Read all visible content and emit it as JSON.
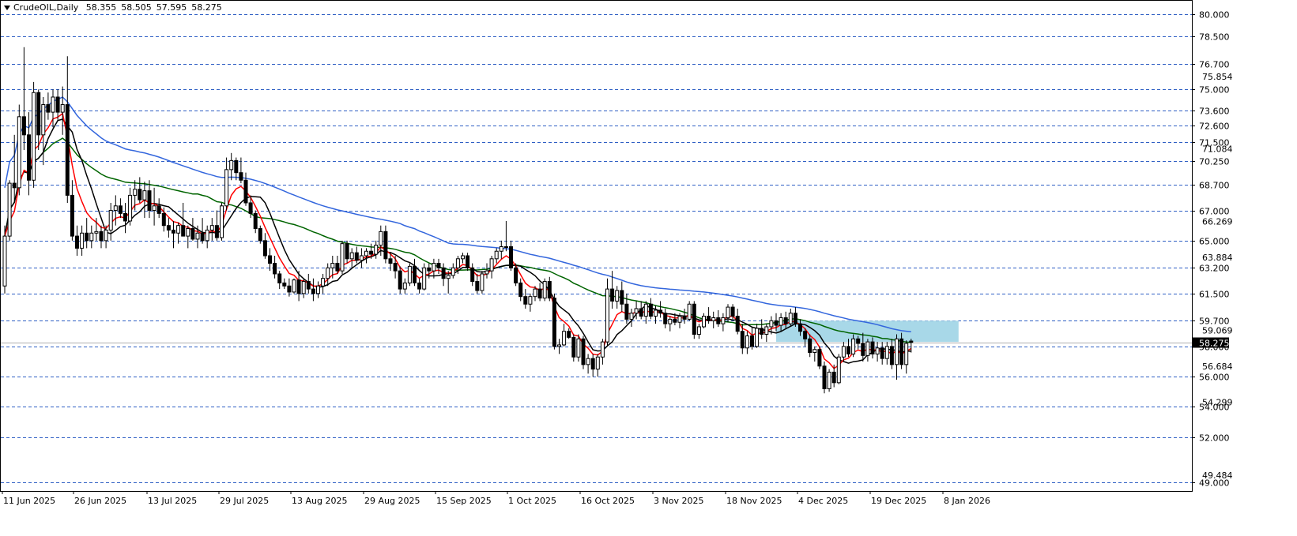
{
  "header": {
    "symbol_timeframe": "CrudeOIL,Daily",
    "open": "58.355",
    "high": "58.505",
    "low": "57.595",
    "close": "58.275"
  },
  "colors": {
    "background": "#ffffff",
    "gridline": "#2f5fc4",
    "candle": "#000000",
    "ma_red": "#ff0000",
    "ma_black": "#000000",
    "ma_green": "#006400",
    "ma_blue": "#3366dd",
    "zone": "#a8d8e8",
    "price_line": "#b0b0b0"
  },
  "chart_data": {
    "type": "candlestick",
    "title": "CrudeOIL,Daily",
    "ylim": [
      48.8,
      80.4
    ],
    "grid": "horizontal dashed lines at level labels",
    "price_levels": [
      "80.000",
      "78.500",
      "76.700",
      "75.000",
      "73.600",
      "72.600",
      "71.500",
      "70.250",
      "68.700",
      "67.000",
      "65.000",
      "63.200",
      "61.500",
      "59.700",
      "58.000",
      "56.000",
      "54.000",
      "52.000",
      "49.000"
    ],
    "extra_scale_labels": [
      "75.854",
      "71.084",
      "66.269",
      "63.884",
      "59.069",
      "56.684",
      "54.299",
      "49.484"
    ],
    "current_price": "58.275",
    "x_labels": [
      "11 Jun 2025",
      "26 Jun 2025",
      "13 Jul 2025",
      "29 Jul 2025",
      "13 Aug 2025",
      "29 Aug 2025",
      "15 Sep 2025",
      "1 Oct 2025",
      "16 Oct 2025",
      "3 Nov 2025",
      "18 Nov 2025",
      "4 Dec 2025",
      "19 Dec 2025",
      "8 Jan 2026"
    ],
    "zone": {
      "from_label": "4 Dec 2025",
      "to_label": "8 Jan 2026",
      "y_low": 58.3,
      "y_high": 59.7
    },
    "candles": [
      [
        62.0,
        66.0,
        61.5,
        65.3
      ],
      [
        65.3,
        69.0,
        65.0,
        68.8
      ],
      [
        68.8,
        72.0,
        67.5,
        68.5
      ],
      [
        68.5,
        74.0,
        68.0,
        73.2
      ],
      [
        73.2,
        77.8,
        71.0,
        72.0
      ],
      [
        72.0,
        73.5,
        68.0,
        69.0
      ],
      [
        69.0,
        75.5,
        68.5,
        74.8
      ],
      [
        74.8,
        75.0,
        71.0,
        72.0
      ],
      [
        72.0,
        74.5,
        70.0,
        74.0
      ],
      [
        74.0,
        74.8,
        73.0,
        73.5
      ],
      [
        73.5,
        75.0,
        72.5,
        74.5
      ],
      [
        74.5,
        75.0,
        73.0,
        73.5
      ],
      [
        73.5,
        75.2,
        72.0,
        74.0
      ],
      [
        74.0,
        77.2,
        67.5,
        68.0
      ],
      [
        68.0,
        69.0,
        65.0,
        65.3
      ],
      [
        65.3,
        66.0,
        64.0,
        64.5
      ],
      [
        64.5,
        66.0,
        64.0,
        65.5
      ],
      [
        65.5,
        66.5,
        64.5,
        65.0
      ],
      [
        65.0,
        66.0,
        64.5,
        65.5
      ],
      [
        65.5,
        66.5,
        65.0,
        65.6
      ],
      [
        65.6,
        66.0,
        64.5,
        65.0
      ],
      [
        65.0,
        66.0,
        64.5,
        65.7
      ],
      [
        65.7,
        67.5,
        65.0,
        67.0
      ],
      [
        67.0,
        68.0,
        66.0,
        67.3
      ],
      [
        67.3,
        67.8,
        66.5,
        66.8
      ],
      [
        66.8,
        67.5,
        65.5,
        66.3
      ],
      [
        66.3,
        68.5,
        66.0,
        68.0
      ],
      [
        68.0,
        69.0,
        67.0,
        68.4
      ],
      [
        68.4,
        69.2,
        67.5,
        67.7
      ],
      [
        67.7,
        68.9,
        66.5,
        68.3
      ],
      [
        68.3,
        69.0,
        66.5,
        67.0
      ],
      [
        67.0,
        68.5,
        66.0,
        67.3
      ],
      [
        67.3,
        67.8,
        66.5,
        66.8
      ],
      [
        66.8,
        67.2,
        65.6,
        66.0
      ],
      [
        66.0,
        66.5,
        65.2,
        65.7
      ],
      [
        65.7,
        66.3,
        64.5,
        65.5
      ],
      [
        65.5,
        66.2,
        64.8,
        66.0
      ],
      [
        66.0,
        67.5,
        65.5,
        65.3
      ],
      [
        65.3,
        66.0,
        64.5,
        65.8
      ],
      [
        65.8,
        66.5,
        65.0,
        65.1
      ],
      [
        65.1,
        66.0,
        64.5,
        65.5
      ],
      [
        65.5,
        66.5,
        64.8,
        65.0
      ],
      [
        65.0,
        66.0,
        64.5,
        65.7
      ],
      [
        65.7,
        66.5,
        65.0,
        66.0
      ],
      [
        66.0,
        67.0,
        65.0,
        65.2
      ],
      [
        65.2,
        67.5,
        65.0,
        67.3
      ],
      [
        67.3,
        70.5,
        67.0,
        69.7
      ],
      [
        69.7,
        70.8,
        69.0,
        70.3
      ],
      [
        70.3,
        70.5,
        69.0,
        69.5
      ],
      [
        69.5,
        70.5,
        68.8,
        69.0
      ],
      [
        69.0,
        69.5,
        67.3,
        67.5
      ],
      [
        67.5,
        68.0,
        66.5,
        66.8
      ],
      [
        66.8,
        67.0,
        65.5,
        65.8
      ],
      [
        65.8,
        66.0,
        64.8,
        65.0
      ],
      [
        65.0,
        65.5,
        63.8,
        64.0
      ],
      [
        64.0,
        64.5,
        63.0,
        63.5
      ],
      [
        63.5,
        64.0,
        62.5,
        62.8
      ],
      [
        62.8,
        63.0,
        61.8,
        62.2
      ],
      [
        62.2,
        62.5,
        61.8,
        62.0
      ],
      [
        62.0,
        62.5,
        61.3,
        61.6
      ],
      [
        61.6,
        62.5,
        61.5,
        62.4
      ],
      [
        62.4,
        63.0,
        61.0,
        61.5
      ],
      [
        61.5,
        62.5,
        61.2,
        62.3
      ],
      [
        62.3,
        62.8,
        61.5,
        61.8
      ],
      [
        61.8,
        62.5,
        61.0,
        61.5
      ],
      [
        61.5,
        62.3,
        61.2,
        62.0
      ],
      [
        62.0,
        62.8,
        61.5,
        62.5
      ],
      [
        62.5,
        63.5,
        62.0,
        63.2
      ],
      [
        63.2,
        64.0,
        62.5,
        63.5
      ],
      [
        63.5,
        64.0,
        62.8,
        63.0
      ],
      [
        63.0,
        65.0,
        62.8,
        64.8
      ],
      [
        64.8,
        65.0,
        63.5,
        63.8
      ],
      [
        63.8,
        64.5,
        63.2,
        64.2
      ],
      [
        64.2,
        64.6,
        63.5,
        63.7
      ],
      [
        63.7,
        64.5,
        63.2,
        64.0
      ],
      [
        64.0,
        64.5,
        63.5,
        64.3
      ],
      [
        64.3,
        64.8,
        63.8,
        64.1
      ],
      [
        64.1,
        65.0,
        63.8,
        64.7
      ],
      [
        64.7,
        66.0,
        64.0,
        65.6
      ],
      [
        65.6,
        66.0,
        63.5,
        63.8
      ],
      [
        63.8,
        64.2,
        63.0,
        63.5
      ],
      [
        63.5,
        64.0,
        62.5,
        63.0
      ],
      [
        63.0,
        63.3,
        61.5,
        61.8
      ],
      [
        61.8,
        62.5,
        61.5,
        62.2
      ],
      [
        62.2,
        63.5,
        62.0,
        63.3
      ],
      [
        63.3,
        63.8,
        62.0,
        62.2
      ],
      [
        62.2,
        62.5,
        61.5,
        61.8
      ],
      [
        61.8,
        63.5,
        61.7,
        63.2
      ],
      [
        63.2,
        63.5,
        62.5,
        63.0
      ],
      [
        63.0,
        63.8,
        62.5,
        63.5
      ],
      [
        63.5,
        63.8,
        62.8,
        63.2
      ],
      [
        63.2,
        63.5,
        62.0,
        62.5
      ],
      [
        62.5,
        63.0,
        61.5,
        62.7
      ],
      [
        62.7,
        63.5,
        62.5,
        63.2
      ],
      [
        63.2,
        64.0,
        62.8,
        63.8
      ],
      [
        63.8,
        64.2,
        63.5,
        64.0
      ],
      [
        64.0,
        64.2,
        63.0,
        63.2
      ],
      [
        63.2,
        63.5,
        62.0,
        62.3
      ],
      [
        62.3,
        62.8,
        61.5,
        61.7
      ],
      [
        61.7,
        63.0,
        61.5,
        62.8
      ],
      [
        62.8,
        63.5,
        62.5,
        63.0
      ],
      [
        63.0,
        64.0,
        62.5,
        63.8
      ],
      [
        63.8,
        64.5,
        63.5,
        64.3
      ],
      [
        64.3,
        65.0,
        63.8,
        64.6
      ],
      [
        64.6,
        66.3,
        64.3,
        64.6
      ],
      [
        64.6,
        65.0,
        63.0,
        63.2
      ],
      [
        63.2,
        63.5,
        62.0,
        62.2
      ],
      [
        62.2,
        62.5,
        61.0,
        61.3
      ],
      [
        61.3,
        61.8,
        60.5,
        60.8
      ],
      [
        60.8,
        61.5,
        60.3,
        61.3
      ],
      [
        61.3,
        62.0,
        61.0,
        61.8
      ],
      [
        61.8,
        62.2,
        61.0,
        61.2
      ],
      [
        61.2,
        62.5,
        61.0,
        62.3
      ],
      [
        62.3,
        62.6,
        61.0,
        61.2
      ],
      [
        61.2,
        61.5,
        57.8,
        58.0
      ],
      [
        58.0,
        58.5,
        57.5,
        58.1
      ],
      [
        58.1,
        59.5,
        58.0,
        59.0
      ],
      [
        59.0,
        59.2,
        58.5,
        58.6
      ],
      [
        58.6,
        58.8,
        57.0,
        57.3
      ],
      [
        57.3,
        58.8,
        57.0,
        58.5
      ],
      [
        58.5,
        58.7,
        56.5,
        56.8
      ],
      [
        56.8,
        57.5,
        56.2,
        57.2
      ],
      [
        57.2,
        57.5,
        56.0,
        56.5
      ],
      [
        56.5,
        57.5,
        56.0,
        57.3
      ],
      [
        57.3,
        58.5,
        56.8,
        58.3
      ],
      [
        58.3,
        62.5,
        58.0,
        61.8
      ],
      [
        61.8,
        63.0,
        60.5,
        61.0
      ],
      [
        61.0,
        62.0,
        60.5,
        61.7
      ],
      [
        61.7,
        62.3,
        60.3,
        60.8
      ],
      [
        60.8,
        61.5,
        59.5,
        59.8
      ],
      [
        59.8,
        60.5,
        59.3,
        60.2
      ],
      [
        60.2,
        61.0,
        59.8,
        60.5
      ],
      [
        60.5,
        61.0,
        59.8,
        60.0
      ],
      [
        60.0,
        61.0,
        59.5,
        60.8
      ],
      [
        60.8,
        61.2,
        59.8,
        60.0
      ],
      [
        60.0,
        60.7,
        59.5,
        60.4
      ],
      [
        60.4,
        61.0,
        59.9,
        60.2
      ],
      [
        60.2,
        60.5,
        59.2,
        59.5
      ],
      [
        59.5,
        60.0,
        59.0,
        59.8
      ],
      [
        59.8,
        60.2,
        59.4,
        59.6
      ],
      [
        59.6,
        60.2,
        59.2,
        60.0
      ],
      [
        60.0,
        60.5,
        59.5,
        59.8
      ],
      [
        59.8,
        61.0,
        59.7,
        60.8
      ],
      [
        60.8,
        61.0,
        58.5,
        58.8
      ],
      [
        58.8,
        59.5,
        58.5,
        59.3
      ],
      [
        59.3,
        60.2,
        59.2,
        60.0
      ],
      [
        60.0,
        60.6,
        59.5,
        59.7
      ],
      [
        59.7,
        60.3,
        59.2,
        59.9
      ],
      [
        59.9,
        60.4,
        59.3,
        59.5
      ],
      [
        59.5,
        60.2,
        59.0,
        59.9
      ],
      [
        59.9,
        60.8,
        59.6,
        60.6
      ],
      [
        60.6,
        60.8,
        59.8,
        60.0
      ],
      [
        60.0,
        60.5,
        58.8,
        59.0
      ],
      [
        59.0,
        59.5,
        57.5,
        57.9
      ],
      [
        57.9,
        59.0,
        57.5,
        58.7
      ],
      [
        58.7,
        59.3,
        57.8,
        58.0
      ],
      [
        58.0,
        59.5,
        57.9,
        59.2
      ],
      [
        59.2,
        59.8,
        58.5,
        58.8
      ],
      [
        58.8,
        59.5,
        58.3,
        59.3
      ],
      [
        59.3,
        60.0,
        58.8,
        59.7
      ],
      [
        59.7,
        60.2,
        59.0,
        59.4
      ],
      [
        59.4,
        60.2,
        59.0,
        59.9
      ],
      [
        59.9,
        60.3,
        59.2,
        59.5
      ],
      [
        59.5,
        60.5,
        59.3,
        60.2
      ],
      [
        60.2,
        60.6,
        59.3,
        59.5
      ],
      [
        59.5,
        59.8,
        58.7,
        59.0
      ],
      [
        59.0,
        59.2,
        58.0,
        58.5
      ],
      [
        58.5,
        58.8,
        57.3,
        57.6
      ],
      [
        57.6,
        58.0,
        57.0,
        57.8
      ],
      [
        57.8,
        58.0,
        56.5,
        56.7
      ],
      [
        56.7,
        57.0,
        54.9,
        55.2
      ],
      [
        55.2,
        56.5,
        55.0,
        56.3
      ],
      [
        56.3,
        56.8,
        55.3,
        55.6
      ],
      [
        55.6,
        57.5,
        55.5,
        57.3
      ],
      [
        57.3,
        58.3,
        57.0,
        58.0
      ],
      [
        58.0,
        58.5,
        57.3,
        57.5
      ],
      [
        57.5,
        58.8,
        57.3,
        58.5
      ],
      [
        58.5,
        58.7,
        57.8,
        58.2
      ],
      [
        58.2,
        58.9,
        57.0,
        57.4
      ],
      [
        57.4,
        58.5,
        57.0,
        58.3
      ],
      [
        58.3,
        58.6,
        57.2,
        57.5
      ],
      [
        57.5,
        58.3,
        57.0,
        57.9
      ],
      [
        57.9,
        58.3,
        56.8,
        57.2
      ],
      [
        57.2,
        58.3,
        56.8,
        58.0
      ],
      [
        58.0,
        58.5,
        56.5,
        56.8
      ],
      [
        56.8,
        58.8,
        55.8,
        58.5
      ],
      [
        58.5,
        58.9,
        56.5,
        56.8
      ],
      [
        56.8,
        58.4,
        56.2,
        58.2
      ],
      [
        58.355,
        58.505,
        57.595,
        58.275
      ]
    ]
  }
}
